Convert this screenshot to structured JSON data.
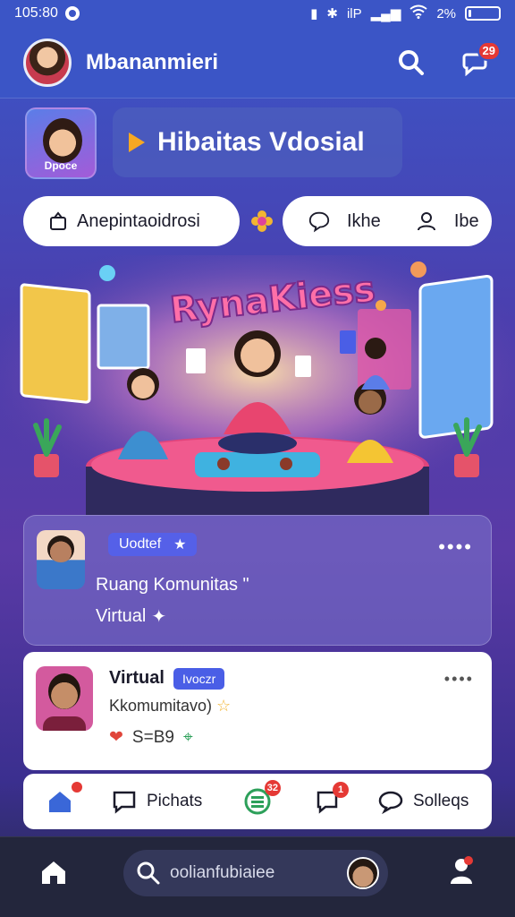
{
  "status_bar": {
    "time": "105:80",
    "signal_text": "ilP",
    "battery_percent": "2%",
    "battery_level": 0.1
  },
  "header": {
    "username": "Mbananmieri",
    "messages_badge": "29"
  },
  "channel": {
    "thumb_caption": "Dpoce",
    "title": "Hibaitas Vdosial"
  },
  "actions": {
    "announce_label": "Anepintaoidrosi",
    "like_label": "Ikhe",
    "follow_label": "Ibe"
  },
  "hero": {
    "title": "RynaKiess"
  },
  "post1": {
    "tag": "Uodtef",
    "line1": "Ruang Komunitas",
    "line1_suffix": "\"",
    "line2": "Virtual"
  },
  "post2": {
    "name": "Virtual",
    "tag": "Ivoczr",
    "subtitle": "Kkomumitavo)",
    "stat": "S=B9"
  },
  "tabbar": {
    "home_badge": "",
    "chats_label": "Pichats",
    "feed_badge": "32",
    "notif_badge": "1",
    "stories_label": "Solleqs"
  },
  "bottom_nav": {
    "search_placeholder": "oolianfubiaiee",
    "profile_badge": ""
  },
  "colors": {
    "header_blue": "#3b55c6",
    "badge_red": "#e53935",
    "tag_blue": "#5560e8",
    "play_orange": "#f7a823"
  }
}
